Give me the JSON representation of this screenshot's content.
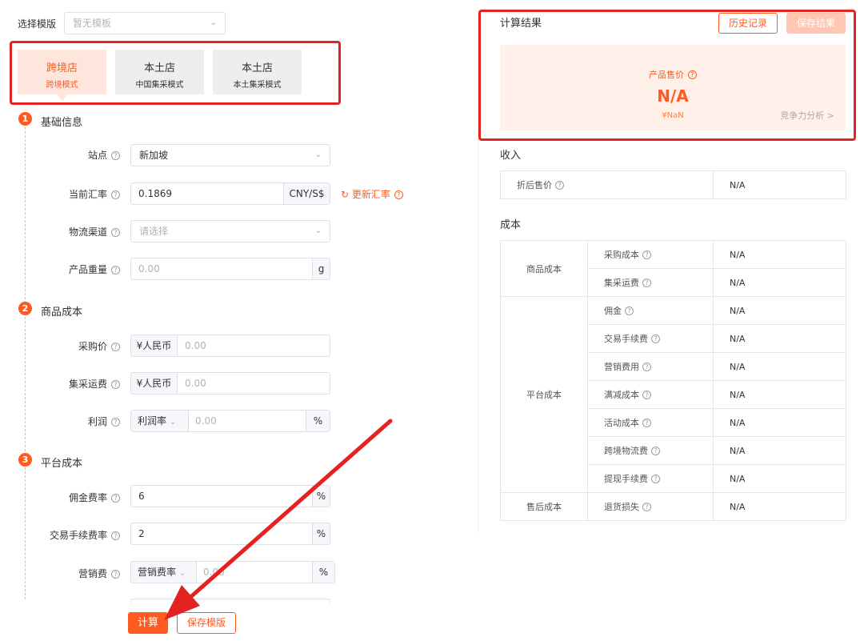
{
  "template": {
    "label": "选择模版",
    "placeholder": "暂无模板"
  },
  "modes": [
    {
      "title": "跨境店",
      "sub": "跨境模式",
      "active": true
    },
    {
      "title": "本土店",
      "sub": "中国集采模式",
      "active": false
    },
    {
      "title": "本土店",
      "sub": "本土集采模式",
      "active": false
    }
  ],
  "sections": {
    "basic": {
      "num": "1",
      "title": "基础信息"
    },
    "goods": {
      "num": "2",
      "title": "商品成本"
    },
    "platform": {
      "num": "3",
      "title": "平台成本"
    }
  },
  "fields": {
    "site": {
      "label": "站点",
      "value": "新加坡"
    },
    "rate": {
      "label": "当前汇率",
      "value": "0.1869",
      "unit": "CNY/S$",
      "refresh": "更新汇率"
    },
    "logistics": {
      "label": "物流渠道",
      "placeholder": "请选择"
    },
    "weight": {
      "label": "产品重量",
      "placeholder": "0.00",
      "unit": "g"
    },
    "purchase": {
      "label": "采购价",
      "prefix": "¥人民币",
      "placeholder": "0.00"
    },
    "freight": {
      "label": "集采运费",
      "prefix": "¥人民币",
      "placeholder": "0.00"
    },
    "profit": {
      "label": "利润",
      "mode": "利润率",
      "placeholder": "0.00",
      "unit": "%"
    },
    "commission": {
      "label": "佣金费率",
      "value": "6",
      "unit": "%"
    },
    "fee": {
      "label": "交易手续费率",
      "value": "2",
      "unit": "%"
    },
    "marketing": {
      "label": "营销费",
      "mode": "营销费率",
      "placeholder": "0.00",
      "unit": "%"
    }
  },
  "actions": {
    "calc": "计算",
    "save_tpl": "保存模版"
  },
  "result": {
    "title": "计算结果",
    "history": "历史记录",
    "save": "保存结果",
    "price_label": "产品售价",
    "price_value": "N/A",
    "price_sub": "¥NaN",
    "compete": "竞争力分析 >"
  },
  "income": {
    "title": "收入",
    "rows": [
      {
        "item": "折后售价",
        "value": "N/A"
      }
    ]
  },
  "cost": {
    "title": "成本",
    "groups": [
      {
        "name": "商品成本",
        "rows": [
          {
            "item": "采购成本",
            "value": "N/A"
          },
          {
            "item": "集采运费",
            "value": "N/A"
          }
        ]
      },
      {
        "name": "平台成本",
        "rows": [
          {
            "item": "佣金",
            "value": "N/A"
          },
          {
            "item": "交易手续费",
            "value": "N/A"
          },
          {
            "item": "营销费用",
            "value": "N/A"
          },
          {
            "item": "满减成本",
            "value": "N/A"
          },
          {
            "item": "活动成本",
            "value": "N/A"
          },
          {
            "item": "跨境物流费",
            "value": "N/A"
          },
          {
            "item": "提现手续费",
            "value": "N/A"
          }
        ]
      },
      {
        "name": "售后成本",
        "rows": [
          {
            "item": "退货损失",
            "value": "N/A"
          }
        ]
      }
    ]
  },
  "colors": {
    "accent": "#ff5a1f",
    "annotation": "#e52222"
  }
}
